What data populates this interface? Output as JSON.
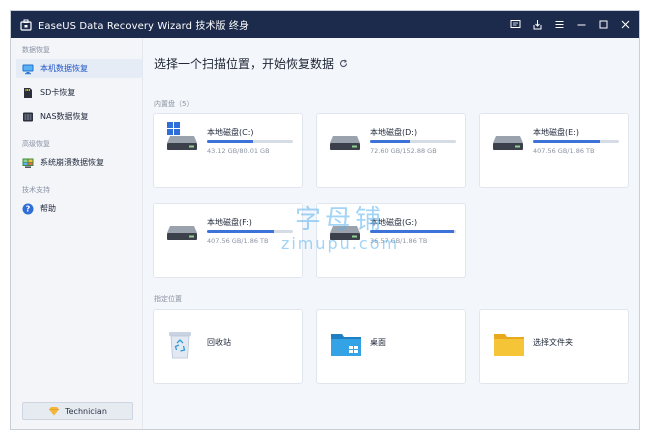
{
  "window": {
    "title": "EaseUS Data Recovery Wizard 技术版 终身"
  },
  "colors": {
    "titlebar": "#1c2a4b",
    "accent": "#1f55c4",
    "progress": "#3d73d9",
    "folder_yellow": "#f5c437"
  },
  "sidebar": {
    "sections": [
      {
        "label": "数据恢复",
        "items": [
          {
            "label": "本机数据恢复",
            "icon": "monitor-icon",
            "active": true
          },
          {
            "label": "SD卡恢复",
            "icon": "sd-card-icon",
            "active": false
          },
          {
            "label": "NAS数据恢复",
            "icon": "nas-icon",
            "active": false
          }
        ]
      },
      {
        "label": "高级恢复",
        "items": [
          {
            "label": "系统崩溃数据恢复",
            "icon": "system-crash-icon",
            "active": false
          }
        ]
      },
      {
        "label": "技术支持",
        "items": [
          {
            "label": "帮助",
            "icon": "help-icon",
            "active": false
          }
        ]
      }
    ],
    "technician_label": "Technician"
  },
  "main": {
    "heading": "选择一个扫描位置，开始恢复数据",
    "internal_label": "内置盘（5）",
    "drives": [
      {
        "name": "本地磁盘(C:)",
        "size": "43.12 GB/80.01 GB",
        "used_fraction": 0.54,
        "system": true
      },
      {
        "name": "本地磁盘(D:)",
        "size": "72.60 GB/152.88 GB",
        "used_fraction": 0.47,
        "system": false
      },
      {
        "name": "本地磁盘(E:)",
        "size": "407.56 GB/1.86 TB",
        "used_fraction": 0.78,
        "system": false
      },
      {
        "name": "本地磁盘(F:)",
        "size": "407.56 GB/1.86 TB",
        "used_fraction": 0.78,
        "system": false
      },
      {
        "name": "本地磁盘(G:)",
        "size": "36.57 GB/1.86 TB",
        "used_fraction": 0.98,
        "system": false
      }
    ],
    "location_label": "指定位置",
    "locations": [
      {
        "name": "回收站",
        "icon": "recycle-bin-icon"
      },
      {
        "name": "桌面",
        "icon": "desktop-icon"
      },
      {
        "name": "选择文件夹",
        "icon": "folder-icon"
      }
    ]
  },
  "watermark": {
    "cn": "字母铺",
    "en": "zimupu.com"
  }
}
